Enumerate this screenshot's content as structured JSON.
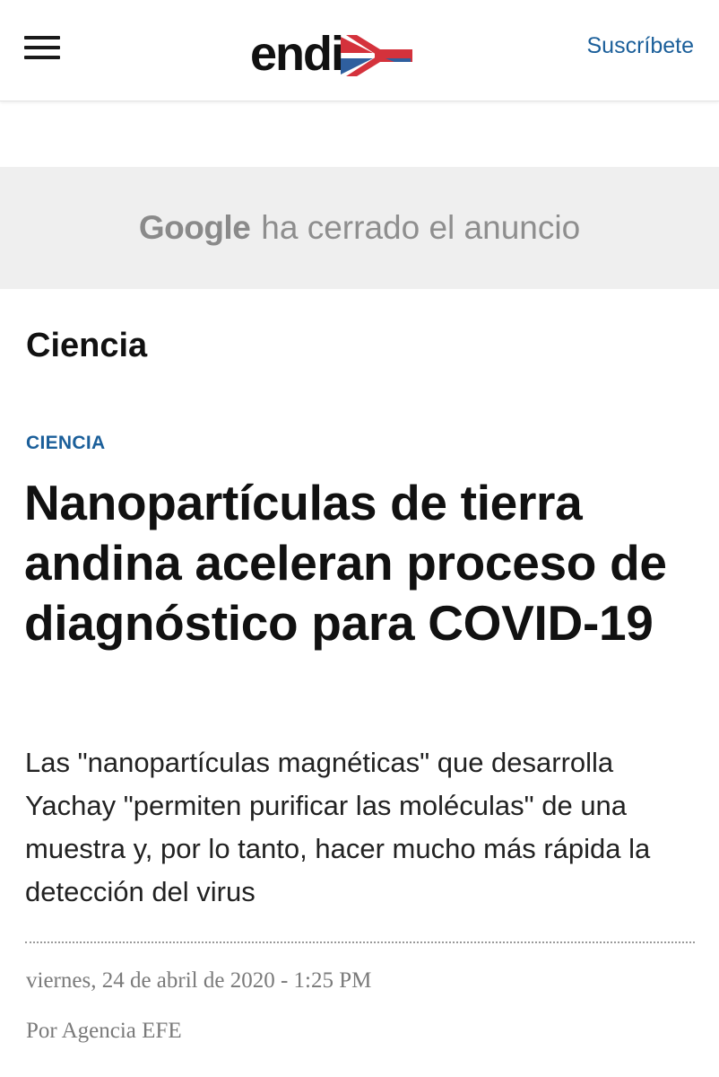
{
  "header": {
    "menu_icon": "hamburger-menu-icon",
    "logo_text": "endi",
    "logo_colors": {
      "red": "#d4323c",
      "blue": "#2f5f9e"
    },
    "subscribe_label": "Suscríbete"
  },
  "ad": {
    "brand": "Google",
    "message": "ha cerrado el anuncio"
  },
  "section": {
    "title": "Ciencia"
  },
  "article": {
    "kicker": "CIENCIA",
    "headline": "Nanopartículas de tierra andina aceleran proceso de diagnóstico para COVID-19",
    "summary": "Las \"nanopartículas magnéticas\" que desarrolla Yachay \"permiten purificar las moléculas\" de una muestra y, por lo tanto, hacer mucho más rápida la detección del virus",
    "date": "viernes, 24 de abril de 2020 - 1:25 PM",
    "byline": "Por Agencia EFE"
  },
  "colors": {
    "accent_blue": "#1b5f9a",
    "ad_background": "#efefef"
  }
}
